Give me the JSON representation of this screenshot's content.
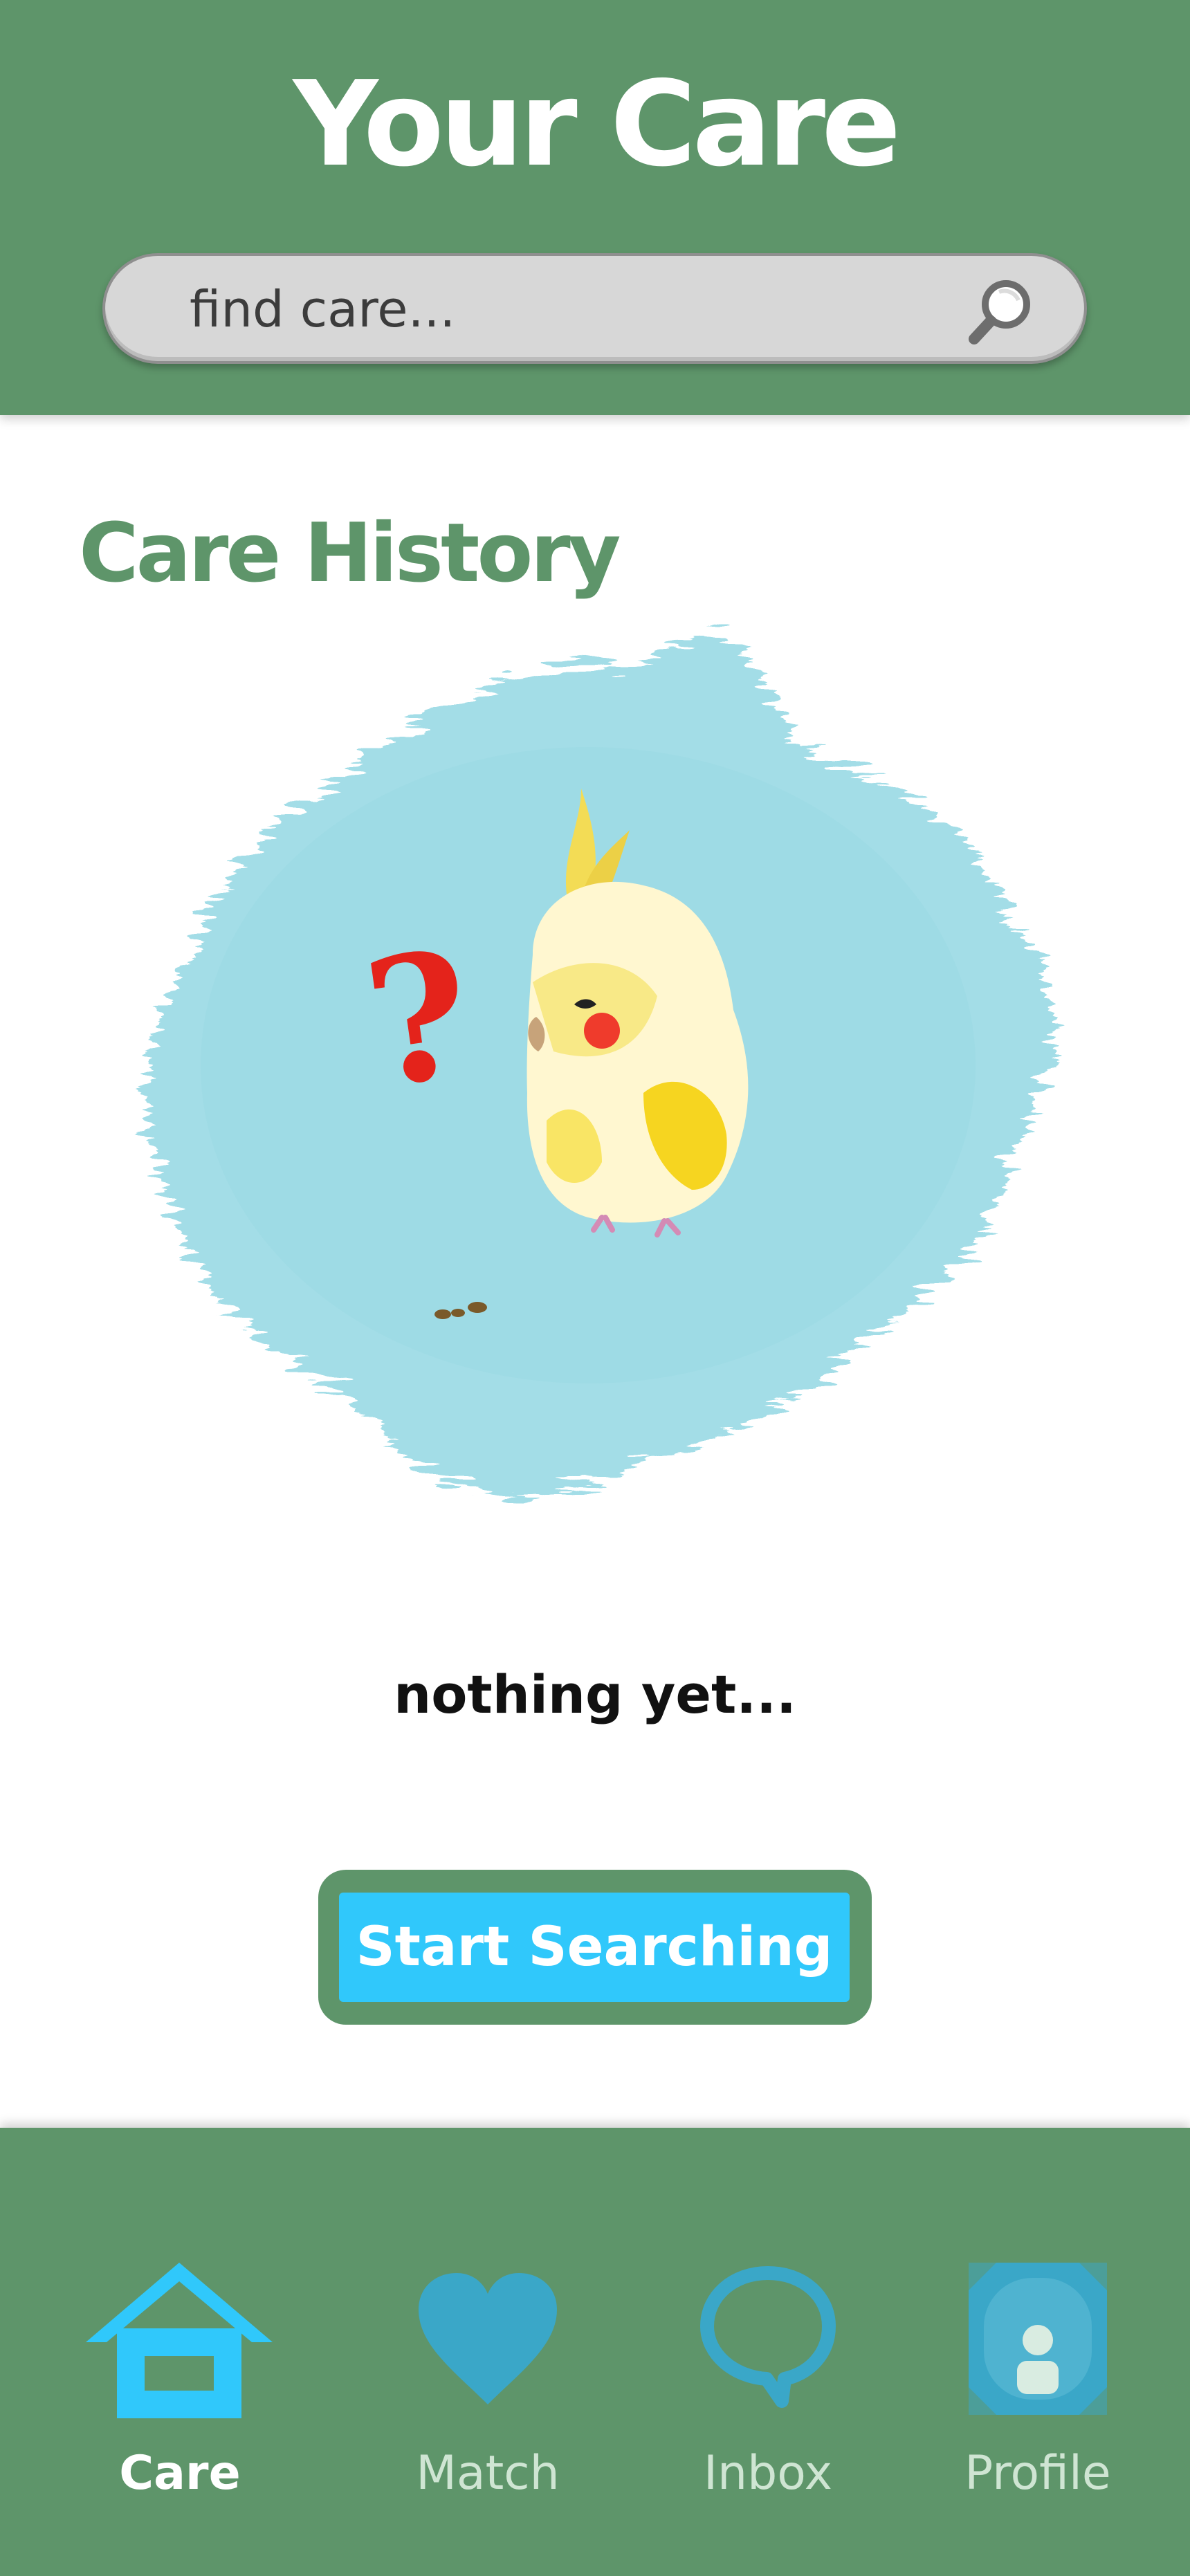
{
  "header": {
    "title": "Your Care",
    "search": {
      "placeholder": "find care...",
      "icon": "search-icon"
    }
  },
  "main": {
    "section_title": "Care History",
    "illustration": {
      "subject": "cockatiel",
      "question_mark": "?",
      "colors": {
        "splash": "#9fdce6",
        "question_mark": "#e4231b",
        "bird_body": "#fff6c8",
        "bird_wing": "#f6da25",
        "cheek": "#ef3b2c"
      }
    },
    "empty_state_text": "nothing yet...",
    "cta_label": "Start Searching"
  },
  "tabs": [
    {
      "label": "Care",
      "icon": "house-icon",
      "active": true
    },
    {
      "label": "Match",
      "icon": "heart-icon",
      "active": false
    },
    {
      "label": "Inbox",
      "icon": "speech-bubble-icon",
      "active": false
    },
    {
      "label": "Profile",
      "icon": "profile-icon",
      "active": false
    }
  ],
  "colors": {
    "header_green": "#5e956a",
    "accent_blue": "#30c8fb",
    "icon_blue": "#3aa7c8",
    "background": "#ffffff"
  }
}
